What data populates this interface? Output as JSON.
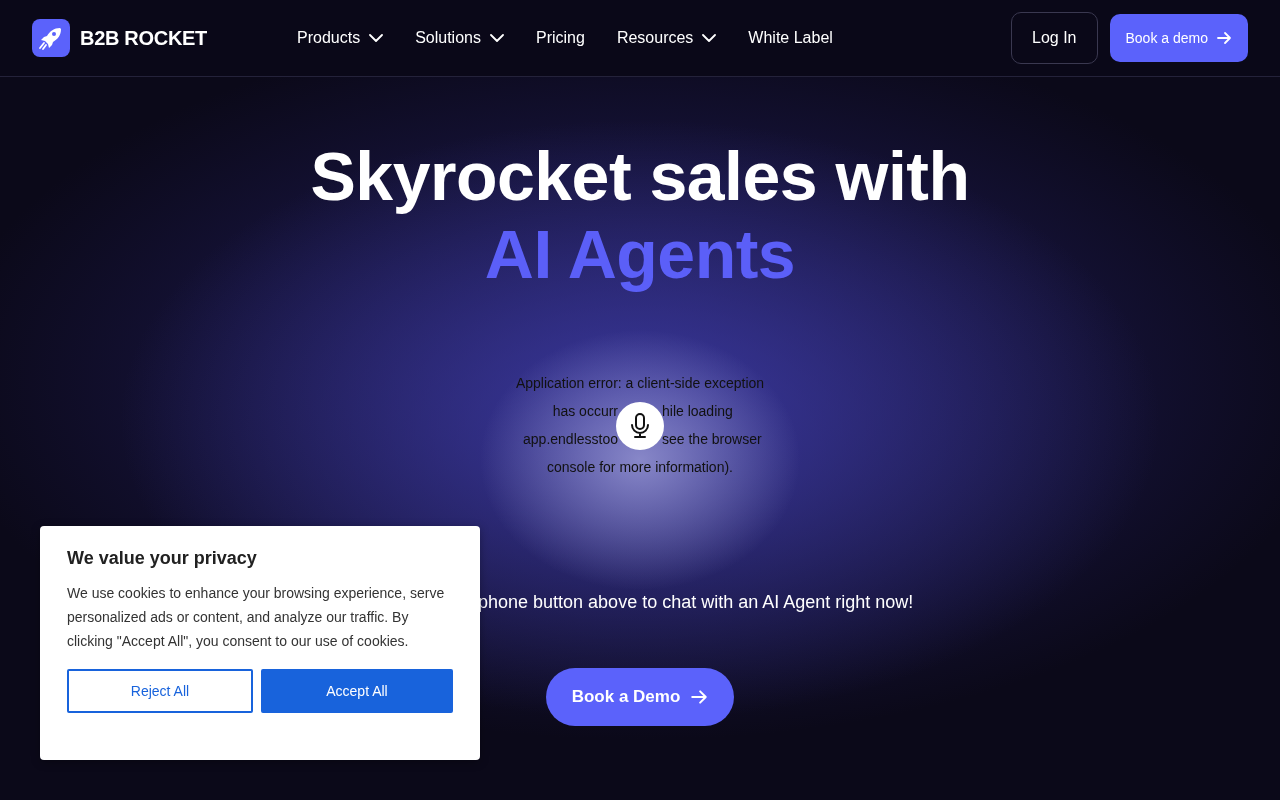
{
  "header": {
    "logo": "B2B ROCKET",
    "nav": [
      {
        "label": "Products",
        "kind": "dropdown"
      },
      {
        "label": "Solutions",
        "kind": "dropdown"
      },
      {
        "label": "Pricing",
        "kind": "link"
      },
      {
        "label": "Resources",
        "kind": "dropdown"
      },
      {
        "label": "White Label",
        "kind": "link"
      }
    ],
    "login": "Log In",
    "cta": "Book a demo"
  },
  "hero": {
    "title": "Skyrocket sales with",
    "highlight": "AI Agents",
    "error_lines": [
      [
        "Application error: a client-side exception"
      ],
      [
        "has occurr",
        "hile loading"
      ],
      [
        "app.endlesstoo",
        "see the browser"
      ],
      [
        "console for more information)."
      ]
    ],
    "tagline": "phone button above to chat with an AI Agent right now!",
    "cta": "Book a Demo"
  },
  "cookie_banner": {
    "title": "We value your privacy",
    "text": "We use cookies to enhance your browsing experience, serve personalized ads or content, and analyze our traffic. By clicking \"Accept All\", you consent to our use of cookies.",
    "buttons": [
      {
        "label": "Reject All",
        "kind": "outline"
      },
      {
        "label": "Accept All",
        "kind": "filled"
      }
    ]
  }
}
